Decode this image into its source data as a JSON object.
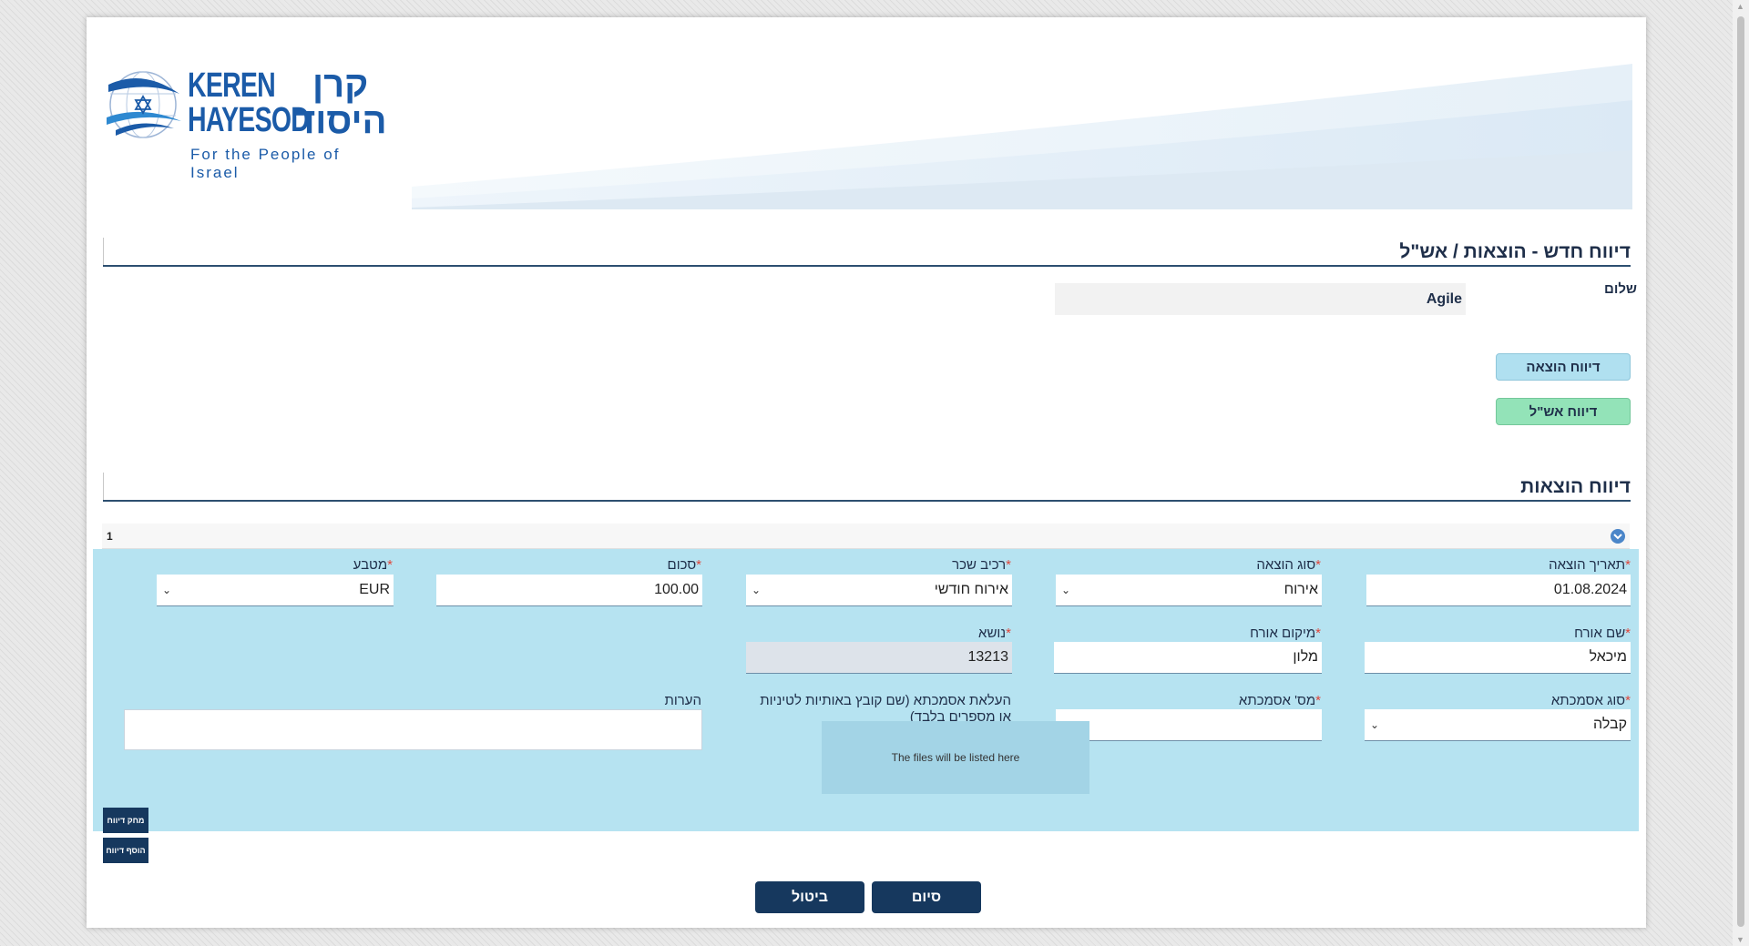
{
  "logo": {
    "english_line1": "KEREN",
    "english_line2": "HAYESOD",
    "hebrew_line1": "קרן",
    "hebrew_line2": "היסוד",
    "tagline": "For the People of Israel"
  },
  "page": {
    "title": "דיווח חדש - הוצאות / אש\"ל",
    "greeting_label": "שלום",
    "username": "Agile",
    "report_expense_button": "דיווח הוצאה",
    "report_ashal_button": "דיווח אש\"ל",
    "expenses_section_title": "דיווח הוצאות"
  },
  "expense_row": {
    "number": "1",
    "fields": {
      "expense_date": {
        "label": "תאריך הוצאה",
        "required": "*",
        "value": "01.08.2024"
      },
      "expense_type": {
        "label": "סוג הוצאה",
        "required": "*",
        "value": "אירוח"
      },
      "salary_component": {
        "label": "רכיב שכר",
        "required": "*",
        "value": "אירוח חודשי"
      },
      "amount": {
        "label": "סכום",
        "required": "*",
        "value": "100.00"
      },
      "currency": {
        "label": "מטבע",
        "required": "*",
        "value": "EUR"
      },
      "guest_name": {
        "label": "שם אורח",
        "required": "*",
        "value": "מיכאל"
      },
      "guest_location": {
        "label": "מיקום אורח",
        "required": "*",
        "value": "מלון"
      },
      "subject": {
        "label": "נושא",
        "required": "*",
        "value": "13213"
      },
      "reference_type": {
        "label": "סוג אסמכתא",
        "required": "*",
        "value": "קבלה"
      },
      "reference_number": {
        "label": "מס' אסמכתא",
        "required": "*",
        "value": ""
      },
      "upload": {
        "label": "העלאת אסמכתא (שם קובץ באותיות לטיניות או מספרים בלבד)",
        "placeholder": "The files will be listed here"
      },
      "notes": {
        "label": "הערות",
        "value": ""
      }
    }
  },
  "buttons": {
    "delete_report": "מחק דיווח",
    "add_report": "הוסף דיווח",
    "finish": "סיום",
    "cancel": "ביטול"
  },
  "colors": {
    "brand_dark": "#16385e",
    "panel_bg": "#b6e3f1",
    "expense_button": "#b0e0f0",
    "ashal_button": "#93e3b8",
    "required_mark": "#e0463b",
    "logo_blue": "#1b5ba8"
  }
}
